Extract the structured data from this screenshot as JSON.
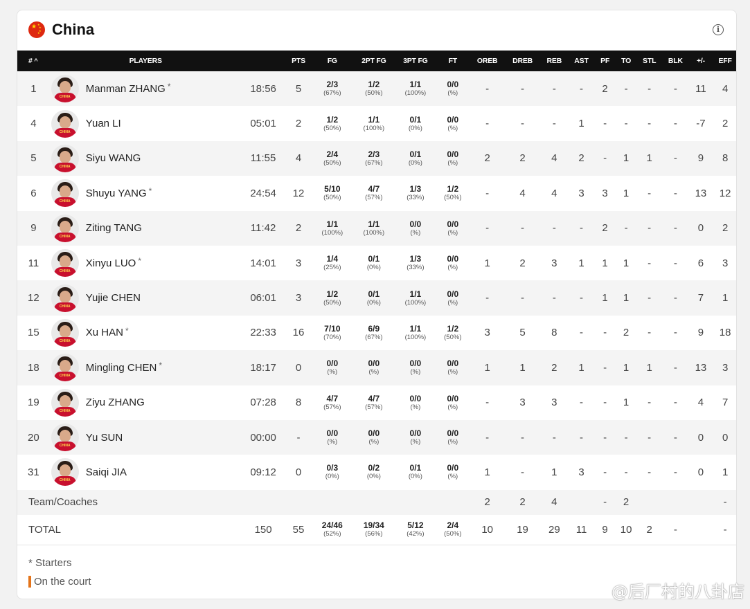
{
  "team": {
    "name": "China"
  },
  "columns": [
    "#",
    "PLAYERS",
    "",
    "PTS",
    "FG",
    "2PT FG",
    "3PT FG",
    "FT",
    "OREB",
    "DREB",
    "REB",
    "AST",
    "PF",
    "TO",
    "STL",
    "BLK",
    "+/-",
    "EFF"
  ],
  "sort_indicator": "^",
  "players": [
    {
      "number": "1",
      "name": "Manman ZHANG",
      "starter": true,
      "min": "18:56",
      "pts": "5",
      "fg": "2/3",
      "fg_pct": "(67%)",
      "fg2": "1/2",
      "fg2_pct": "(50%)",
      "fg3": "1/1",
      "fg3_pct": "(100%)",
      "ft": "0/0",
      "ft_pct": "(%)",
      "oreb": "-",
      "dreb": "-",
      "reb": "-",
      "ast": "-",
      "pf": "2",
      "to": "-",
      "stl": "-",
      "blk": "-",
      "pm": "11",
      "eff": "4"
    },
    {
      "number": "4",
      "name": "Yuan LI",
      "starter": false,
      "min": "05:01",
      "pts": "2",
      "fg": "1/2",
      "fg_pct": "(50%)",
      "fg2": "1/1",
      "fg2_pct": "(100%)",
      "fg3": "0/1",
      "fg3_pct": "(0%)",
      "ft": "0/0",
      "ft_pct": "(%)",
      "oreb": "-",
      "dreb": "-",
      "reb": "-",
      "ast": "1",
      "pf": "-",
      "to": "-",
      "stl": "-",
      "blk": "-",
      "pm": "-7",
      "eff": "2"
    },
    {
      "number": "5",
      "name": "Siyu WANG",
      "starter": false,
      "min": "11:55",
      "pts": "4",
      "fg": "2/4",
      "fg_pct": "(50%)",
      "fg2": "2/3",
      "fg2_pct": "(67%)",
      "fg3": "0/1",
      "fg3_pct": "(0%)",
      "ft": "0/0",
      "ft_pct": "(%)",
      "oreb": "2",
      "dreb": "2",
      "reb": "4",
      "ast": "2",
      "pf": "-",
      "to": "1",
      "stl": "1",
      "blk": "-",
      "pm": "9",
      "eff": "8"
    },
    {
      "number": "6",
      "name": "Shuyu YANG",
      "starter": true,
      "min": "24:54",
      "pts": "12",
      "fg": "5/10",
      "fg_pct": "(50%)",
      "fg2": "4/7",
      "fg2_pct": "(57%)",
      "fg3": "1/3",
      "fg3_pct": "(33%)",
      "ft": "1/2",
      "ft_pct": "(50%)",
      "oreb": "-",
      "dreb": "4",
      "reb": "4",
      "ast": "3",
      "pf": "3",
      "to": "1",
      "stl": "-",
      "blk": "-",
      "pm": "13",
      "eff": "12"
    },
    {
      "number": "9",
      "name": "Ziting TANG",
      "starter": false,
      "min": "11:42",
      "pts": "2",
      "fg": "1/1",
      "fg_pct": "(100%)",
      "fg2": "1/1",
      "fg2_pct": "(100%)",
      "fg3": "0/0",
      "fg3_pct": "(%)",
      "ft": "0/0",
      "ft_pct": "(%)",
      "oreb": "-",
      "dreb": "-",
      "reb": "-",
      "ast": "-",
      "pf": "2",
      "to": "-",
      "stl": "-",
      "blk": "-",
      "pm": "0",
      "eff": "2"
    },
    {
      "number": "11",
      "name": "Xinyu LUO",
      "starter": true,
      "min": "14:01",
      "pts": "3",
      "fg": "1/4",
      "fg_pct": "(25%)",
      "fg2": "0/1",
      "fg2_pct": "(0%)",
      "fg3": "1/3",
      "fg3_pct": "(33%)",
      "ft": "0/0",
      "ft_pct": "(%)",
      "oreb": "1",
      "dreb": "2",
      "reb": "3",
      "ast": "1",
      "pf": "1",
      "to": "1",
      "stl": "-",
      "blk": "-",
      "pm": "6",
      "eff": "3"
    },
    {
      "number": "12",
      "name": "Yujie CHEN",
      "starter": false,
      "min": "06:01",
      "pts": "3",
      "fg": "1/2",
      "fg_pct": "(50%)",
      "fg2": "0/1",
      "fg2_pct": "(0%)",
      "fg3": "1/1",
      "fg3_pct": "(100%)",
      "ft": "0/0",
      "ft_pct": "(%)",
      "oreb": "-",
      "dreb": "-",
      "reb": "-",
      "ast": "-",
      "pf": "1",
      "to": "1",
      "stl": "-",
      "blk": "-",
      "pm": "7",
      "eff": "1"
    },
    {
      "number": "15",
      "name": "Xu HAN",
      "starter": true,
      "min": "22:33",
      "pts": "16",
      "fg": "7/10",
      "fg_pct": "(70%)",
      "fg2": "6/9",
      "fg2_pct": "(67%)",
      "fg3": "1/1",
      "fg3_pct": "(100%)",
      "ft": "1/2",
      "ft_pct": "(50%)",
      "oreb": "3",
      "dreb": "5",
      "reb": "8",
      "ast": "-",
      "pf": "-",
      "to": "2",
      "stl": "-",
      "blk": "-",
      "pm": "9",
      "eff": "18"
    },
    {
      "number": "18",
      "name": "Mingling CHEN",
      "starter": true,
      "min": "18:17",
      "pts": "0",
      "fg": "0/0",
      "fg_pct": "(%)",
      "fg2": "0/0",
      "fg2_pct": "(%)",
      "fg3": "0/0",
      "fg3_pct": "(%)",
      "ft": "0/0",
      "ft_pct": "(%)",
      "oreb": "1",
      "dreb": "1",
      "reb": "2",
      "ast": "1",
      "pf": "-",
      "to": "1",
      "stl": "1",
      "blk": "-",
      "pm": "13",
      "eff": "3"
    },
    {
      "number": "19",
      "name": "Ziyu ZHANG",
      "starter": false,
      "min": "07:28",
      "pts": "8",
      "fg": "4/7",
      "fg_pct": "(57%)",
      "fg2": "4/7",
      "fg2_pct": "(57%)",
      "fg3": "0/0",
      "fg3_pct": "(%)",
      "ft": "0/0",
      "ft_pct": "(%)",
      "oreb": "-",
      "dreb": "3",
      "reb": "3",
      "ast": "-",
      "pf": "-",
      "to": "1",
      "stl": "-",
      "blk": "-",
      "pm": "4",
      "eff": "7"
    },
    {
      "number": "20",
      "name": "Yu SUN",
      "starter": false,
      "min": "00:00",
      "pts": "-",
      "fg": "0/0",
      "fg_pct": "(%)",
      "fg2": "0/0",
      "fg2_pct": "(%)",
      "fg3": "0/0",
      "fg3_pct": "(%)",
      "ft": "0/0",
      "ft_pct": "(%)",
      "oreb": "-",
      "dreb": "-",
      "reb": "-",
      "ast": "-",
      "pf": "-",
      "to": "-",
      "stl": "-",
      "blk": "-",
      "pm": "0",
      "eff": "0"
    },
    {
      "number": "31",
      "name": "Saiqi JIA",
      "starter": false,
      "min": "09:12",
      "pts": "0",
      "fg": "0/3",
      "fg_pct": "(0%)",
      "fg2": "0/2",
      "fg2_pct": "(0%)",
      "fg3": "0/1",
      "fg3_pct": "(0%)",
      "ft": "0/0",
      "ft_pct": "(%)",
      "oreb": "1",
      "dreb": "-",
      "reb": "1",
      "ast": "3",
      "pf": "-",
      "to": "-",
      "stl": "-",
      "blk": "-",
      "pm": "0",
      "eff": "1"
    }
  ],
  "team_coaches": {
    "label": "Team/Coaches",
    "oreb": "2",
    "dreb": "2",
    "reb": "4",
    "ast": "",
    "pf": "-",
    "to": "2",
    "stl": "",
    "blk": "",
    "pm": "",
    "eff": "-"
  },
  "total": {
    "label": "TOTAL",
    "min": "150",
    "pts": "55",
    "fg": "24/46",
    "fg_pct": "(52%)",
    "fg2": "19/34",
    "fg2_pct": "(56%)",
    "fg3": "5/12",
    "fg3_pct": "(42%)",
    "ft": "2/4",
    "ft_pct": "(50%)",
    "oreb": "10",
    "dreb": "19",
    "reb": "29",
    "ast": "11",
    "pf": "9",
    "to": "10",
    "stl": "2",
    "blk": "-",
    "pm": "",
    "eff": "-"
  },
  "legend": {
    "starters": "* Starters",
    "on_court": "On the court"
  },
  "watermark": "@后厂村的八卦店",
  "colors": {
    "header_bg": "#111111",
    "jersey": "#c8102e",
    "on_court": "#e4741a",
    "flag": "#de2910"
  },
  "icons": {
    "info": "info-icon",
    "flag": "china-flag-icon"
  }
}
